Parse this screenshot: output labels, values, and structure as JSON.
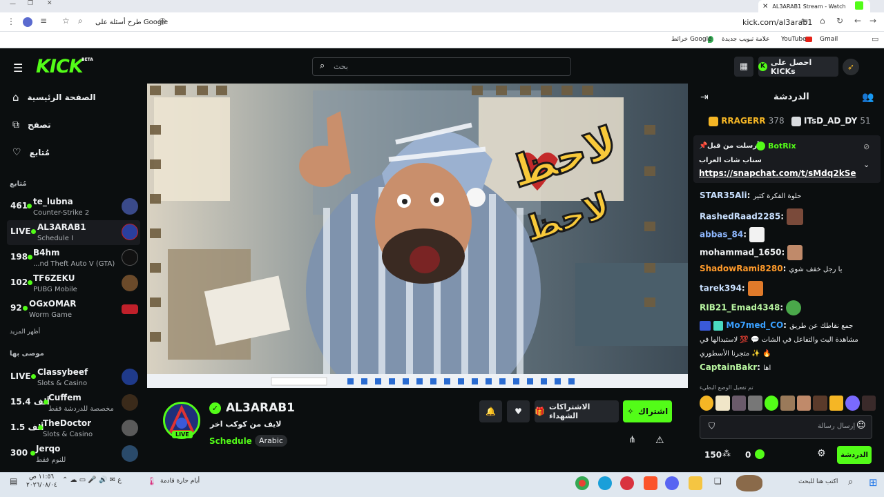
{
  "browser": {
    "tab_title": "AL3ARAB1 Stream - Watch",
    "url": "kick.com/al3arab1",
    "google_search_hint": "طرح أسئلة على Google",
    "bookmarks": [
      "Gmail",
      "YouTube",
      "علامة تبويب جديدة",
      "خرائط Google"
    ]
  },
  "header": {
    "logo": "KICK",
    "beta": "BETA",
    "search_placeholder": "بحث",
    "get_kicks_label": "احصل على KICKs"
  },
  "sidebar": {
    "nav": [
      {
        "label": "الصفحة الرئيسية",
        "icon": "home-icon"
      },
      {
        "label": "تصفح",
        "icon": "browse-icon"
      },
      {
        "label": "مُتابع",
        "icon": "heart-icon"
      }
    ],
    "following_title": "مُتابع",
    "following": [
      {
        "count": "461",
        "name": "te_lubna",
        "category": "Counter-Strike 2",
        "avatar": "#3a4a8a"
      },
      {
        "count": "LIVE",
        "name": "AL3ARAB1",
        "category": "Schedule I",
        "avatar": "#2a3f9e"
      },
      {
        "count": "198",
        "name": "B4hm",
        "category": "...nd Theft Auto V (GTA)",
        "avatar": "#111111"
      },
      {
        "count": "102",
        "name": "TF6ZEKU",
        "category": "PUBG Mobile",
        "avatar": "#6b4a2a"
      },
      {
        "count": "92",
        "name": "OGxOMAR",
        "category": "Worm Game",
        "avatar": "#c0202a"
      }
    ],
    "show_more": "أظهر المزيد",
    "recommended_title": "موصى بها",
    "recommended": [
      {
        "count": "LIVE",
        "name": "Classybeef",
        "category": "Slots & Casino",
        "avatar": "#1f3a8a"
      },
      {
        "count": "15.4 ألف",
        "name": "Cuffem",
        "category": "مخصصة للدردشة فقط",
        "avatar": "#3a2a1a"
      },
      {
        "count": "1.5 ألف",
        "name": "TheDoctor",
        "category": "Slots & Casino",
        "avatar": "#5a5a5a"
      },
      {
        "count": "300",
        "name": "Jerqo",
        "category": "للنوم فقط",
        "avatar": "#2a4a6a"
      }
    ]
  },
  "player": {
    "overlay_text_1": "لاحظ",
    "overlay_text_2": "لاحظ"
  },
  "stream_info": {
    "streamer": "AL3ARAB1",
    "title": "لايف من كوكب اخر",
    "category": "Schedule I",
    "language": "Arabic",
    "live_badge": "LIVE",
    "subscribe_label": "اشتراك",
    "gift_subs_label": "الاشتراكات الشهداء"
  },
  "chat": {
    "title": "الدردشة",
    "leaderboard": [
      {
        "name": "RRAGERR",
        "value": "378",
        "color": "#f5b625"
      },
      {
        "name": "ITsD_AD_DY",
        "value": "51",
        "color": "#d9dcdf"
      }
    ],
    "pinned": {
      "by": "BotRix",
      "pinned_label": "أرسلت من قبل",
      "line": "سناب شات العراب",
      "link": "https://snapchat.com/t/sMdq2kSe"
    },
    "messages": [
      {
        "user": "STAR35Ali",
        "color": "#c9e0ff",
        "text": "حلوة الفكرة كثير",
        "emote": ""
      },
      {
        "user": "RashedRaad2285",
        "color": "#c9e0ff",
        "text": "",
        "emote": "#7a4a3a"
      },
      {
        "user": "abbas_84",
        "color": "#8fb8ff",
        "text": "",
        "emote": "#ffffff"
      },
      {
        "user": "mohammad_1650",
        "color": "#eef0f2",
        "text": "",
        "emote": "#c08a6a"
      },
      {
        "user": "ShadowRami8280",
        "color": "#ff9a2a",
        "text": "يا رجل خفف شوي",
        "emote": ""
      },
      {
        "user": "tarek394",
        "color": "#c9e0ff",
        "text": "",
        "emote": "#e07a2a"
      },
      {
        "user": "RIB21_Emad4348",
        "color": "#b8f5a0",
        "text": "",
        "emote": "#4aa84a"
      },
      {
        "user": "Mo7med_CO",
        "color": "#3aa0ff",
        "text": "جمع نقاطك عن طريق مشاهدة البث والتفاعل في الشات 💬 💯 لاستبدالها في متجرنا الأسطوري ✨ 🔥",
        "emote": ""
      },
      {
        "user": "CaptainBakr",
        "color": "#b8f5a0",
        "text": "اها",
        "emote": ""
      }
    ],
    "emote_bar_label": "تم تفعيل الوضع البطيء",
    "input_placeholder": "إرسال رسالة",
    "points": "150",
    "kicks": "0",
    "chat_button": "الدردشة"
  },
  "taskbar": {
    "search_placeholder": "اكتب هنا للبحث",
    "weather": "أيام حارة قادمة",
    "time": "١١:٥٦ ص",
    "date": "٢٠٢٦/٠٨/٠٤"
  }
}
